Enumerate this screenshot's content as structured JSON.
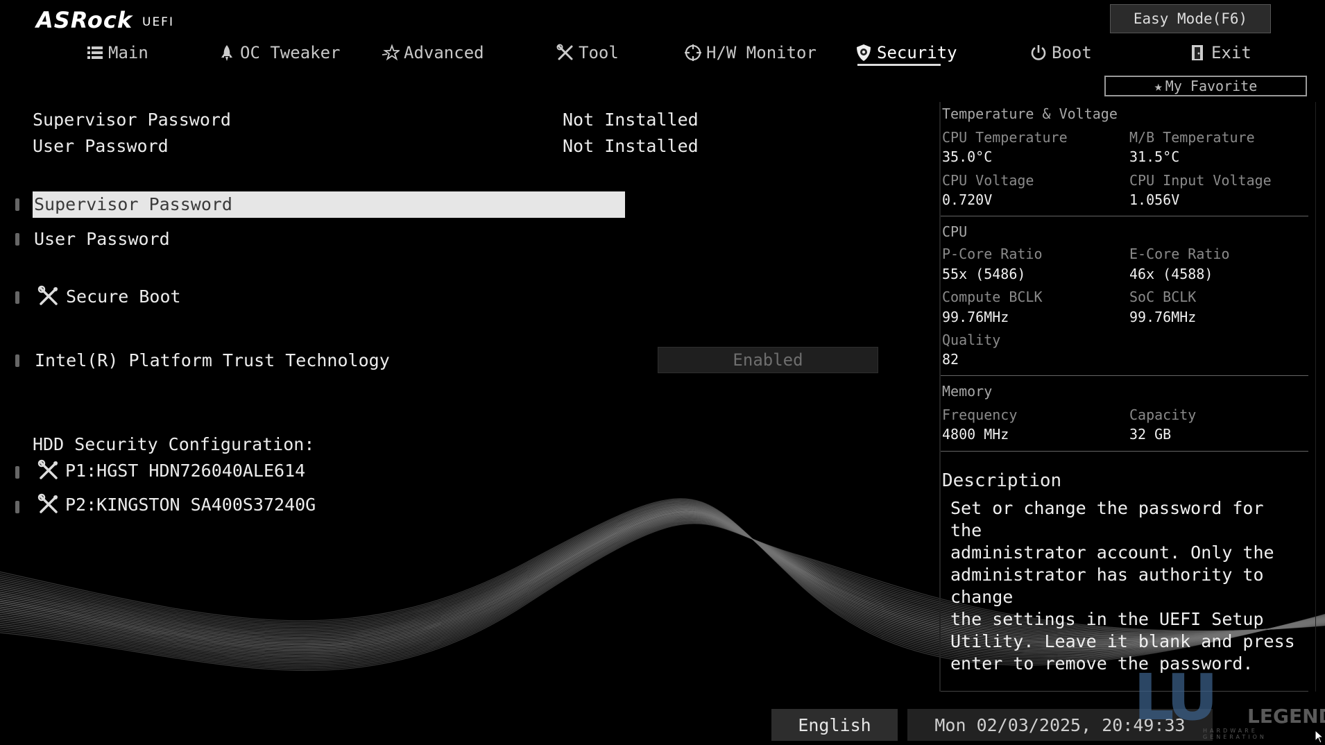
{
  "header": {
    "brand": "ASRock",
    "brand_sub": "UEFI",
    "easy_mode": "Easy Mode(F6)",
    "my_favorite": "My Favorite"
  },
  "tabs": [
    {
      "label": "Main",
      "icon": "list-icon"
    },
    {
      "label": "OC Tweaker",
      "icon": "rocket-icon"
    },
    {
      "label": "Advanced",
      "icon": "star-icon"
    },
    {
      "label": "Tool",
      "icon": "tools-icon"
    },
    {
      "label": "H/W Monitor",
      "icon": "crosshair-icon"
    },
    {
      "label": "Security",
      "icon": "shield-icon",
      "active": true
    },
    {
      "label": "Boot",
      "icon": "power-icon"
    },
    {
      "label": "Exit",
      "icon": "exit-icon"
    }
  ],
  "security": {
    "status": [
      {
        "label": "Supervisor Password",
        "value": "Not Installed"
      },
      {
        "label": "User Password",
        "value": "Not Installed"
      }
    ],
    "items": {
      "supervisor_password": "Supervisor Password",
      "user_password": "User Password",
      "secure_boot": "Secure Boot",
      "ptt_label": "Intel(R) Platform Trust Technology",
      "ptt_value": "Enabled"
    },
    "hdd_title": "HDD Security Configuration:",
    "hdd": [
      "P1:HGST HDN726040ALE614",
      "P2:KINGSTON SA400S37240G"
    ]
  },
  "monitor": {
    "temp_title": "Temperature & Voltage",
    "cpu_temp_label": "CPU Temperature",
    "cpu_temp": "35.0°C",
    "mb_temp_label": "M/B Temperature",
    "mb_temp": "31.5°C",
    "cpu_volt_label": "CPU Voltage",
    "cpu_volt": "0.720V",
    "cpu_in_volt_label": "CPU Input Voltage",
    "cpu_in_volt": "1.056V",
    "cpu_title": "CPU",
    "pcore_label": "P-Core Ratio",
    "pcore": "55x (5486)",
    "ecore_label": "E-Core Ratio",
    "ecore": "46x (4588)",
    "cbclk_label": "Compute BCLK",
    "cbclk": "99.76MHz",
    "socbclk_label": "SoC BCLK",
    "socbclk": "99.76MHz",
    "quality_label": "Quality",
    "quality": "82",
    "mem_title": "Memory",
    "freq_label": "Frequency",
    "freq": "4800 MHz",
    "cap_label": "Capacity",
    "cap": "32 GB"
  },
  "description": {
    "title": "Description",
    "text": "Set or change the password for the\nadministrator account. Only the\nadministrator has authority to change\nthe settings in the UEFI Setup\nUtility. Leave it blank and press\nenter to remove the password."
  },
  "footer": {
    "language": "English",
    "datetime": "Mon 02/03/2025, 20:49:33"
  },
  "watermark": {
    "logo": "LU",
    "text": "LEGEND",
    "sub": "HARDWARE GENERATION"
  },
  "colors": {
    "background": "#000000",
    "selection": "#e6e6e6",
    "text": "#ececec"
  }
}
